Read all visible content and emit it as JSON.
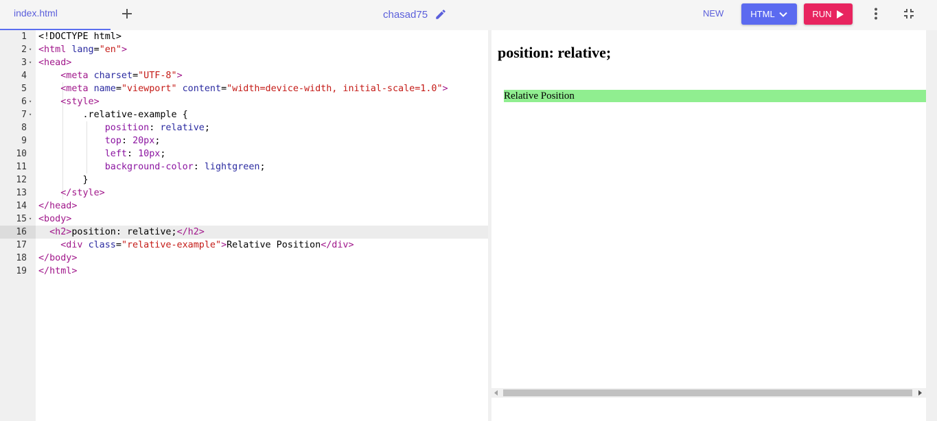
{
  "tabs": {
    "active_file": "index.html"
  },
  "header": {
    "project_name": "chasad75",
    "new_label": "NEW",
    "html_label": "HTML",
    "run_label": "RUN"
  },
  "colors": {
    "accent": "#5b6af0",
    "run": "#e8245f",
    "preview_box": "#90ee90"
  },
  "icons": {
    "add": "plus-icon",
    "edit": "pencil-icon",
    "menu": "kebab-icon",
    "collapse": "collapse-icon"
  },
  "editor": {
    "active_line": 16,
    "line_numbers": [
      "1",
      "2",
      "3",
      "4",
      "5",
      "6",
      "7",
      "8",
      "9",
      "10",
      "11",
      "12",
      "13",
      "14",
      "15",
      "16",
      "17",
      "18",
      "19"
    ],
    "lines": [
      [
        [
          "<!DOCTYPE html>",
          "t-sel"
        ]
      ],
      [
        [
          "<html ",
          "t-tag"
        ],
        [
          "lang",
          "t-attr"
        ],
        [
          "=",
          "t-sel"
        ],
        [
          "\"en\"",
          "t-str"
        ],
        [
          ">",
          "t-tag"
        ]
      ],
      [
        [
          "<head>",
          "t-tag"
        ]
      ],
      [
        [
          "    ",
          ""
        ],
        [
          "<meta ",
          "t-tag"
        ],
        [
          "charset",
          "t-attr"
        ],
        [
          "=",
          "t-sel"
        ],
        [
          "\"UTF-8\"",
          "t-str"
        ],
        [
          ">",
          "t-tag"
        ]
      ],
      [
        [
          "    ",
          ""
        ],
        [
          "<meta ",
          "t-tag"
        ],
        [
          "name",
          "t-attr"
        ],
        [
          "=",
          "t-sel"
        ],
        [
          "\"viewport\"",
          "t-str"
        ],
        [
          " ",
          ""
        ],
        [
          "content",
          "t-attr"
        ],
        [
          "=",
          "t-sel"
        ],
        [
          "\"width=device-width, initial-scale=1.0\"",
          "t-str"
        ],
        [
          ">",
          "t-tag"
        ]
      ],
      [
        [
          "    ",
          ""
        ],
        [
          "<style>",
          "t-tag"
        ]
      ],
      [
        [
          "        .relative-example {",
          "t-sel"
        ]
      ],
      [
        [
          "            ",
          ""
        ],
        [
          "position",
          "t-prop"
        ],
        [
          ": ",
          "t-sel"
        ],
        [
          "relative",
          "t-val"
        ],
        [
          ";",
          "t-sel"
        ]
      ],
      [
        [
          "            ",
          ""
        ],
        [
          "top",
          "t-prop"
        ],
        [
          ": ",
          "t-sel"
        ],
        [
          "20px",
          "t-num"
        ],
        [
          ";",
          "t-sel"
        ]
      ],
      [
        [
          "            ",
          ""
        ],
        [
          "left",
          "t-prop"
        ],
        [
          ": ",
          "t-sel"
        ],
        [
          "10px",
          "t-num"
        ],
        [
          ";",
          "t-sel"
        ]
      ],
      [
        [
          "            ",
          ""
        ],
        [
          "background-color",
          "t-prop"
        ],
        [
          ": ",
          "t-sel"
        ],
        [
          "lightgreen",
          "t-val"
        ],
        [
          ";",
          "t-sel"
        ]
      ],
      [
        [
          "        }",
          "t-sel"
        ]
      ],
      [
        [
          "    ",
          ""
        ],
        [
          "</style>",
          "t-tag"
        ]
      ],
      [
        [
          "</head>",
          "t-tag"
        ]
      ],
      [
        [
          "<body>",
          "t-tag"
        ]
      ],
      [
        [
          "  ",
          ""
        ],
        [
          "<h2>",
          "t-tag"
        ],
        [
          "position: relative;",
          "t-sel"
        ],
        [
          "</h2>",
          "t-tag"
        ]
      ],
      [
        [
          "    ",
          ""
        ],
        [
          "<div ",
          "t-tag"
        ],
        [
          "class",
          "t-attr"
        ],
        [
          "=",
          "t-sel"
        ],
        [
          "\"relative-example\"",
          "t-str"
        ],
        [
          ">",
          "t-tag"
        ],
        [
          "Relative Position",
          "t-sel"
        ],
        [
          "</div>",
          "t-tag"
        ]
      ],
      [
        [
          "</body>",
          "t-tag"
        ]
      ],
      [
        [
          "</html>",
          "t-tag"
        ]
      ]
    ],
    "foldable": [
      2,
      3,
      6,
      7,
      15
    ]
  },
  "preview": {
    "heading": "position: relative;",
    "box_text": "Relative Position"
  }
}
